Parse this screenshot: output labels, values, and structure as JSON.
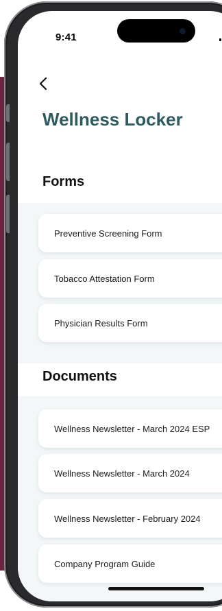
{
  "status_bar": {
    "time": "9:41"
  },
  "header": {
    "back_icon": "chevron-left-icon",
    "title": "Wellness Locker"
  },
  "forms": {
    "heading": "Forms",
    "items": [
      {
        "label": "Preventive Screening Form"
      },
      {
        "label": "Tobacco Attestation Form"
      },
      {
        "label": "Physician Results Form"
      }
    ]
  },
  "documents": {
    "heading": "Documents",
    "items": [
      {
        "label": "Wellness Newsletter - March 2024 ESP"
      },
      {
        "label": "Wellness Newsletter - March 2024"
      },
      {
        "label": "Wellness Newsletter - February 2024"
      },
      {
        "label": "Company Program Guide"
      }
    ]
  },
  "colors": {
    "title_teal": "#2d5b5f",
    "backdrop_maroon": "#6b2542",
    "section_background": "#f3f7f8"
  }
}
